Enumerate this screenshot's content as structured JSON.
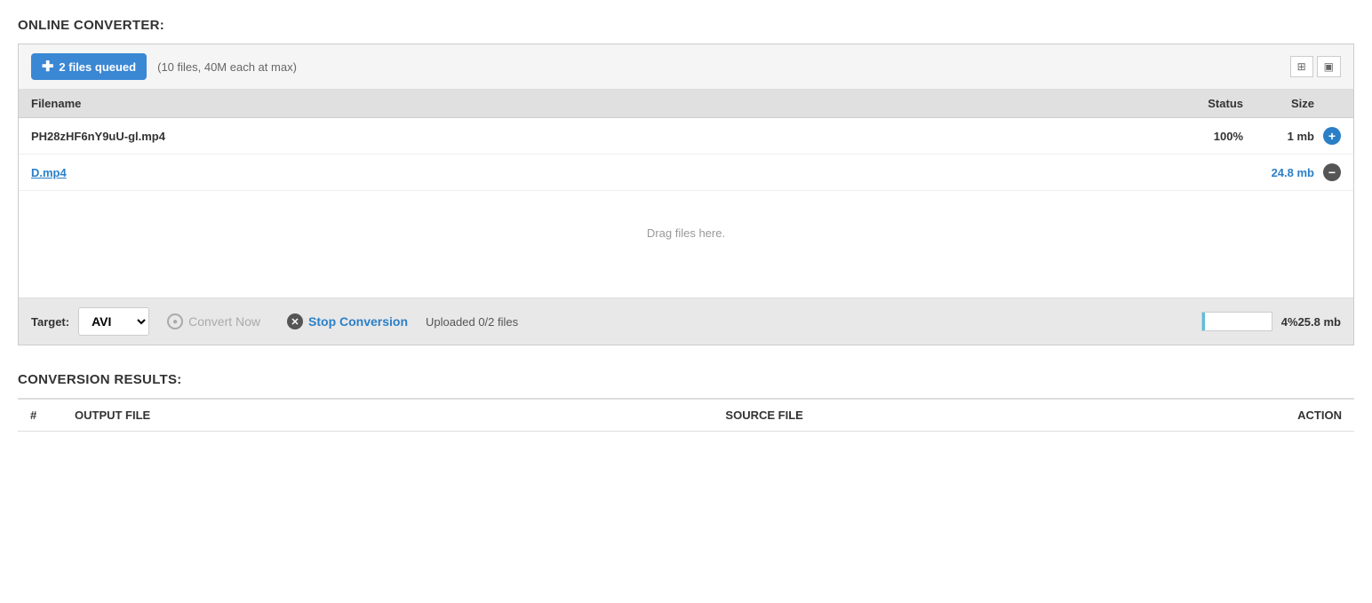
{
  "page": {
    "converter_title": "ONLINE CONVERTER:",
    "results_title": "CONVERSION RESULTS:"
  },
  "top_bar": {
    "add_button_label": "2 files queued",
    "files_info": "(10 files, 40M each at max)"
  },
  "icons": {
    "grid_icon": "⊞",
    "image_icon": "🖼",
    "plus_symbol": "+",
    "minus_symbol": "−",
    "circle_x": "✕",
    "arrow_icon": "▶"
  },
  "table_headers": {
    "filename": "Filename",
    "status": "Status",
    "size": "Size"
  },
  "files": [
    {
      "name": "PH28zHF6nY9uU-gl.mp4",
      "status": "100%",
      "size": "1 mb",
      "is_link": false,
      "action": "plus"
    },
    {
      "name": "D.mp4",
      "status": "",
      "size": "24.8 mb",
      "is_link": true,
      "action": "minus"
    }
  ],
  "drop_zone": {
    "text": "Drag files here."
  },
  "bottom_bar": {
    "target_label": "Target:",
    "target_value": "AVI",
    "convert_btn_label": "Convert Now",
    "stop_btn_label": "Stop Conversion",
    "upload_status": "Uploaded 0/2 files",
    "progress_percent": "4%",
    "progress_value": 4,
    "total_size": "25.8 mb"
  },
  "results_table": {
    "col_number": "#",
    "col_output": "OUTPUT FILE",
    "col_source": "SOURCE FILE",
    "col_action": "ACTION"
  }
}
